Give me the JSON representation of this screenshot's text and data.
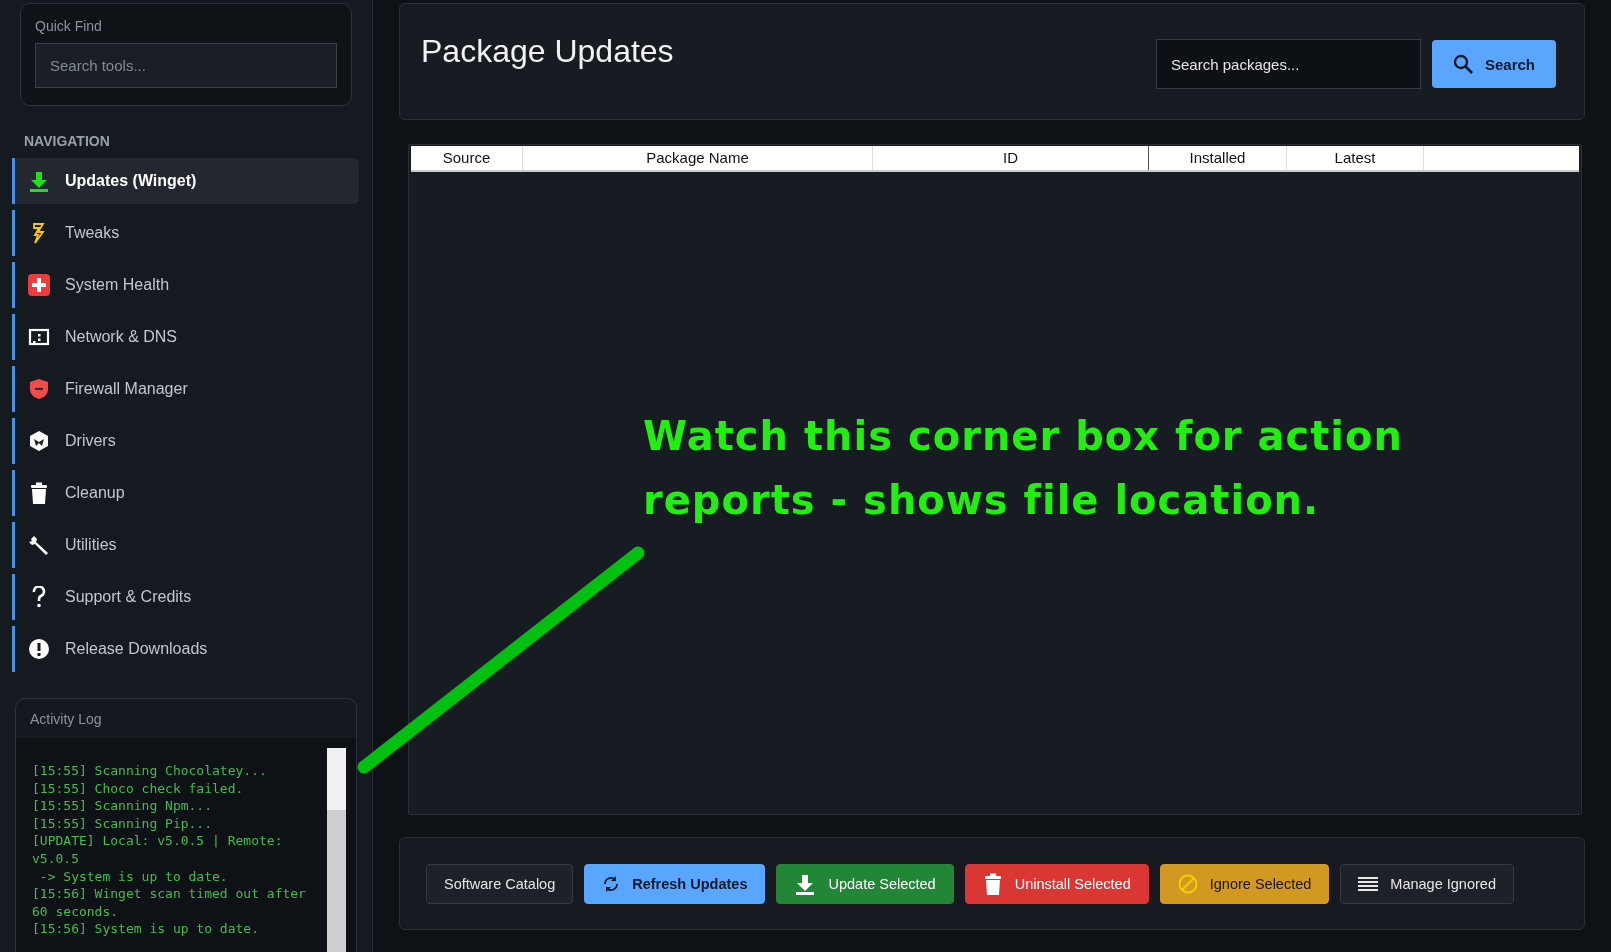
{
  "sidebar": {
    "quick_find": {
      "label": "Quick Find",
      "placeholder": "Search tools..."
    },
    "nav_heading": "NAVIGATION",
    "nav_items": [
      {
        "label": "Updates (Winget)",
        "kind": "download",
        "selected": true
      },
      {
        "label": "Tweaks",
        "kind": "bolt",
        "selected": false
      },
      {
        "label": "System Health",
        "kind": "health",
        "selected": false
      },
      {
        "label": "Network & DNS",
        "kind": "network",
        "selected": false
      },
      {
        "label": "Firewall Manager",
        "kind": "shield",
        "selected": false
      },
      {
        "label": "Drivers",
        "kind": "driver",
        "selected": false
      },
      {
        "label": "Cleanup",
        "kind": "trash",
        "selected": false
      },
      {
        "label": "Utilities",
        "kind": "wrench",
        "selected": false
      },
      {
        "label": "Support & Credits",
        "kind": "question",
        "selected": false
      },
      {
        "label": "Release Downloads",
        "kind": "alert",
        "selected": false
      }
    ],
    "activity_log": {
      "title": "Activity Log",
      "lines": [
        "[15:55] Scanning Chocolatey...",
        "[15:55] Choco check failed.",
        "[15:55] Scanning Npm...",
        "[15:55] Scanning Pip...",
        "[UPDATE] Local: v5.0.5 | Remote: v5.0.5",
        " -> System is up to date.",
        "[15:56] Winget scan timed out after 60 seconds.",
        "[15:56] System is up to date."
      ]
    }
  },
  "main": {
    "title": "Package Updates",
    "search": {
      "placeholder": "Search packages...",
      "button": "Search"
    },
    "table": {
      "columns": [
        "Source",
        "Package Name",
        "ID",
        "Installed",
        "Latest"
      ]
    },
    "actions": [
      {
        "label": "Software Catalog",
        "kind": "catalog"
      },
      {
        "label": "Refresh Updates",
        "kind": "refresh"
      },
      {
        "label": "Update Selected",
        "kind": "update"
      },
      {
        "label": "Uninstall Selected",
        "kind": "uninstall"
      },
      {
        "label": "Ignore Selected",
        "kind": "ignore"
      },
      {
        "label": "Manage Ignored",
        "kind": "manage"
      }
    ]
  },
  "annotation": {
    "text": "Watch this corner box for action reports - shows file location."
  }
}
